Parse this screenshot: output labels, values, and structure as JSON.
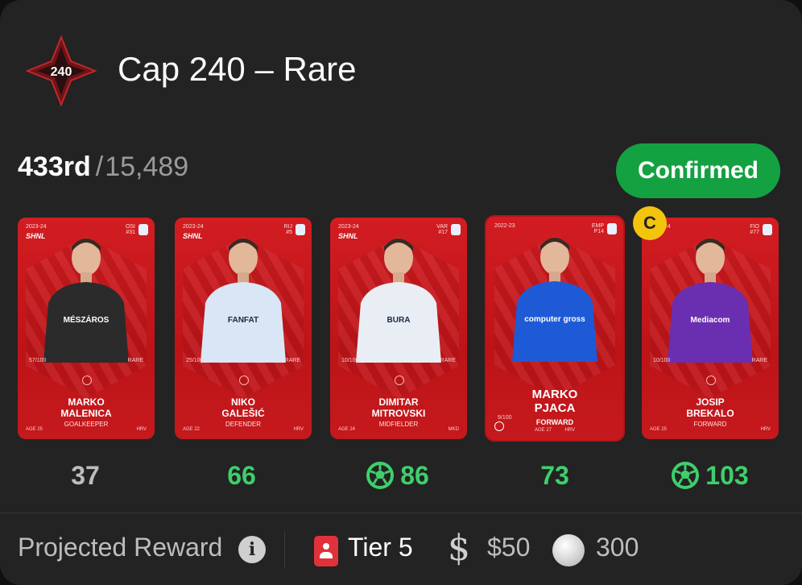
{
  "header": {
    "logo_text": "240",
    "title": "Cap 240 – Rare"
  },
  "rank": {
    "position": "433rd",
    "separator": "/",
    "total": "15,489"
  },
  "status_button": "Confirmed",
  "captain_badge": "C",
  "cards": [
    {
      "season": "2023-24",
      "league": "SHNL",
      "club": "OSI\n#31",
      "serial": "57/100",
      "rarity": "RARE",
      "name": "MARKO\nMALENICA",
      "position": "GOALKEEPER",
      "age": "AGE 25",
      "nationality": "HRV",
      "kit": "#2b2b2b",
      "sponsor": "MÉSZÁROS",
      "score": "37",
      "score_color": "gray",
      "decisive": false
    },
    {
      "season": "2023-24",
      "league": "SHNL",
      "club": "RIJ\n#5",
      "serial": "25/100",
      "rarity": "RARE",
      "name": "NIKO\nGALEŠIĆ",
      "position": "DEFENDER",
      "age": "AGE 22",
      "nationality": "HRV",
      "kit": "#d9e6f5",
      "sponsor": "FANFAT",
      "score": "66",
      "score_color": "green",
      "decisive": false
    },
    {
      "season": "2023-24",
      "league": "SHNL",
      "club": "VAR\n#17",
      "serial": "10/100",
      "rarity": "RARE",
      "name": "DIMITAR\nMITROVSKI",
      "position": "MIDFIELDER",
      "age": "AGE 24",
      "nationality": "MKD",
      "kit": "#e9eef5",
      "sponsor": "BURA",
      "score": "86",
      "score_color": "green",
      "decisive": true
    },
    {
      "season": "2022-23",
      "league": "",
      "club": "EMP\nP14",
      "serial": "9/100",
      "rarity": "",
      "name": "MARKO\nPJACA",
      "position": "FORWARD",
      "age": "AGE 27",
      "nationality": "HRV",
      "kit": "#1e5ad6",
      "sponsor": "computer gross",
      "score": "73",
      "score_color": "green",
      "decisive": false
    },
    {
      "season": "2023-24",
      "league": "",
      "club": "FIO\n#77",
      "serial": "10/100",
      "rarity": "RARE",
      "name": "JOSIP\nBREKALO",
      "position": "FORWARD",
      "age": "AGE 25",
      "nationality": "HRV",
      "kit": "#6a2eb0",
      "sponsor": "Mediacom",
      "score": "103",
      "score_color": "green",
      "decisive": true
    }
  ],
  "footer": {
    "projected_label": "Projected Reward",
    "info_icon": "i",
    "tier": "Tier 5",
    "money_symbol": "$",
    "money": "$50",
    "coins": "300"
  },
  "colors": {
    "background": "#232323",
    "card_red": "#c8181d",
    "confirmed_green": "#14a142",
    "score_green": "#3ecf6c",
    "captain_yellow": "#f2c40c"
  }
}
